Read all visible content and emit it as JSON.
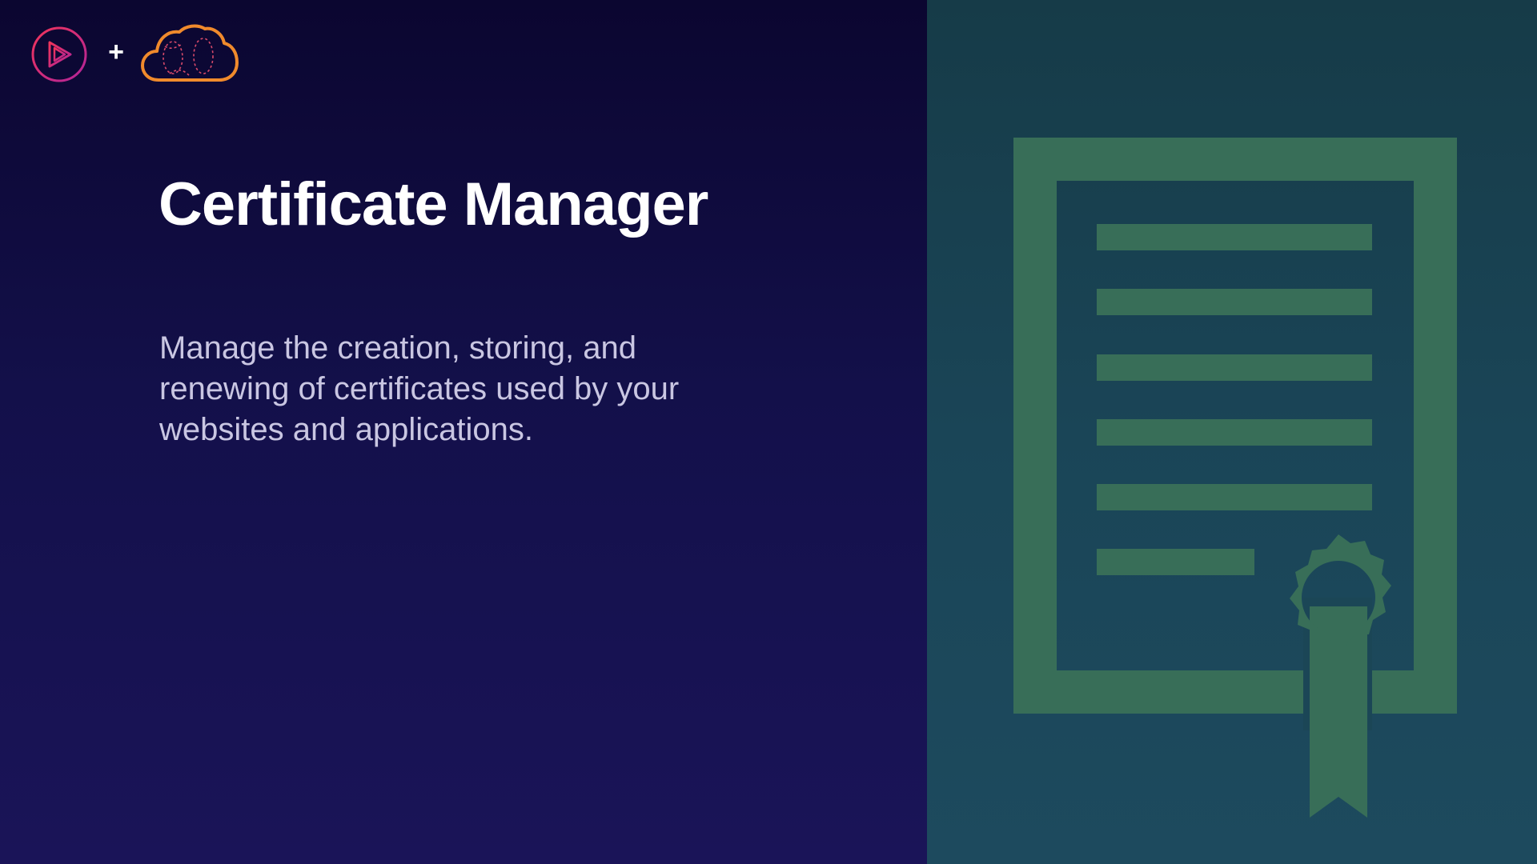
{
  "slide": {
    "title": "Certificate Manager",
    "description": "Manage the creation, storing, and renewing of certificates used by your websites and applications."
  },
  "header": {
    "plus_symbol": "+"
  },
  "icons": {
    "brand_play": "play-logo-icon",
    "brand_cloud": "cloud-logo-icon",
    "illustration": "certificate-icon"
  },
  "colors": {
    "left_background": "#13104a",
    "right_background": "#1a4557",
    "certificate_green": "#386e58",
    "play_logo_gradient_start": "#f0345a",
    "play_logo_gradient_end": "#b1249a",
    "cloud_logo_orange": "#f08a2c",
    "title_color": "#ffffff",
    "description_color": "#c9c6e2"
  }
}
